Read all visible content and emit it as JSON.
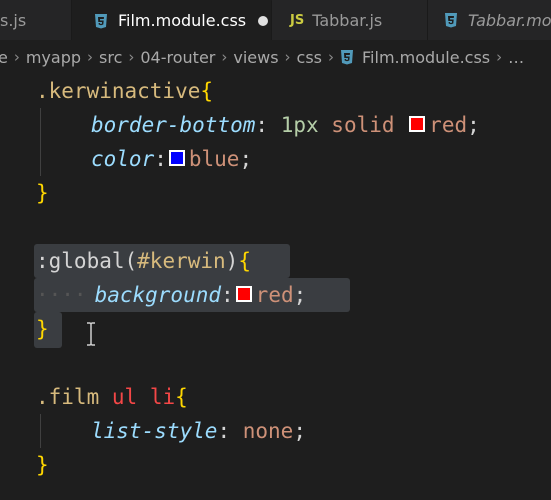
{
  "tabs": [
    {
      "label": "s.js",
      "icon": "js-file-icon"
    },
    {
      "label": "Film.module.css",
      "icon": "css-file-icon",
      "active": true,
      "modified": true
    },
    {
      "label": "Tabbar.js",
      "icon": "js-file-icon",
      "icon_text": "JS"
    },
    {
      "label": "Tabbar.modu",
      "icon": "css-file-icon"
    }
  ],
  "breadcrumb": {
    "items": [
      "e",
      "myapp",
      "src",
      "04-router",
      "views",
      "css",
      "Film.module.css",
      "…"
    ]
  },
  "code": {
    "l1": {
      "selector": ".kerwinactive",
      "brace": "{"
    },
    "l2": {
      "prop": "border-bottom",
      "colon": ":",
      "num": "1",
      "unit": "px",
      "v1": "solid",
      "swatch": "#ff0000",
      "v2": "red",
      "semi": ";"
    },
    "l3": {
      "prop": "color",
      "colon": ":",
      "swatch": "#0000ff",
      "v": "blue",
      "semi": ";"
    },
    "l4": {
      "brace": "}"
    },
    "l6": {
      "pre": ":global(",
      "id": "#kerwin",
      "post": ")",
      "brace": "{"
    },
    "l7": {
      "ws": "····",
      "prop": "background",
      "colon": ":",
      "swatch": "#ff0000",
      "v": "red",
      "semi": ";"
    },
    "l8": {
      "brace": "}"
    },
    "l10": {
      "cls": ".film",
      "t1": "ul",
      "t2": "li",
      "brace": "{"
    },
    "l11": {
      "prop": "list-style",
      "colon": ":",
      "v": "none",
      "semi": ";"
    },
    "l12": {
      "brace": "}"
    }
  },
  "colors": {
    "background": "#1e1e1e",
    "selection": "#3a3d41",
    "css_icon": "#519aba",
    "js_icon": "#cbcb41"
  }
}
